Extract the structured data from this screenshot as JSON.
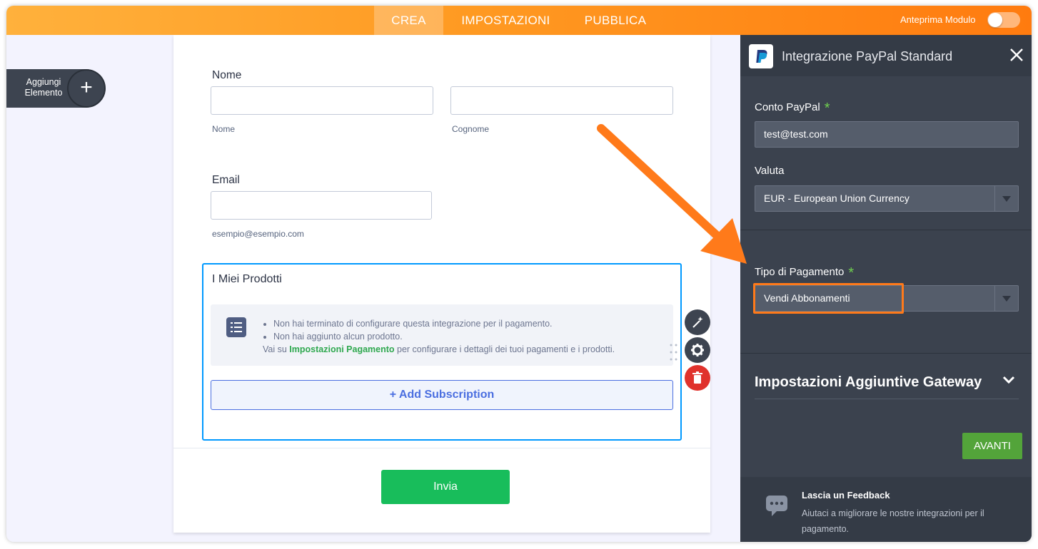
{
  "topbar": {
    "tabs": [
      {
        "label": "CREA",
        "active": true
      },
      {
        "label": "IMPOSTAZIONI",
        "active": false
      },
      {
        "label": "PUBBLICA",
        "active": false
      }
    ],
    "preview_label": "Anteprima Modulo",
    "preview_enabled": false
  },
  "add_element": {
    "label": "Aggiungi Elemento",
    "icon": "plus-icon"
  },
  "form": {
    "name": {
      "label": "Nome",
      "first_sublabel": "Nome",
      "last_sublabel": "Cognome",
      "first_value": "",
      "last_value": ""
    },
    "email": {
      "label": "Email",
      "sublabel": "esempio@esempio.com",
      "value": ""
    },
    "products": {
      "title": "I Miei Prodotti",
      "notices": [
        "Non hai terminato di configurare questa integrazione per il pagamento.",
        "Non hai aggiunto alcun prodotto."
      ],
      "hint_prefix": "Vai su ",
      "hint_link": "Impostazioni Pagamento",
      "hint_suffix": " per configurare i dettagli dei tuoi pagamenti e i prodotti.",
      "add_button": "+ Add Subscription"
    },
    "submit_label": "Invia",
    "tools": [
      "magic-wand-icon",
      "gear-icon",
      "trash-icon"
    ]
  },
  "panel": {
    "title": "Integrazione PayPal Standard",
    "account": {
      "label": "Conto PayPal",
      "value": "test@test.com",
      "required": true
    },
    "currency": {
      "label": "Valuta",
      "value": "EUR - European Union Currency"
    },
    "payment_type": {
      "label": "Tipo di Pagamento",
      "value": "Vendi Abbonamenti",
      "required": true
    },
    "more_settings": "Impostazioni Aggiuntive Gateway",
    "next_button": "AVANTI",
    "feedback": {
      "title": "Lascia un Feedback",
      "text": "Aiutaci a migliorare le nostre integrazioni per il pagamento."
    }
  },
  "colors": {
    "accent_orange": "#ff7b0f",
    "submit_green": "#18bd5b",
    "next_green": "#53a43a",
    "panel_bg": "#3b424e",
    "link_green": "#2fa84f",
    "selection_blue": "#0099ff",
    "delete_red": "#e0322c"
  }
}
